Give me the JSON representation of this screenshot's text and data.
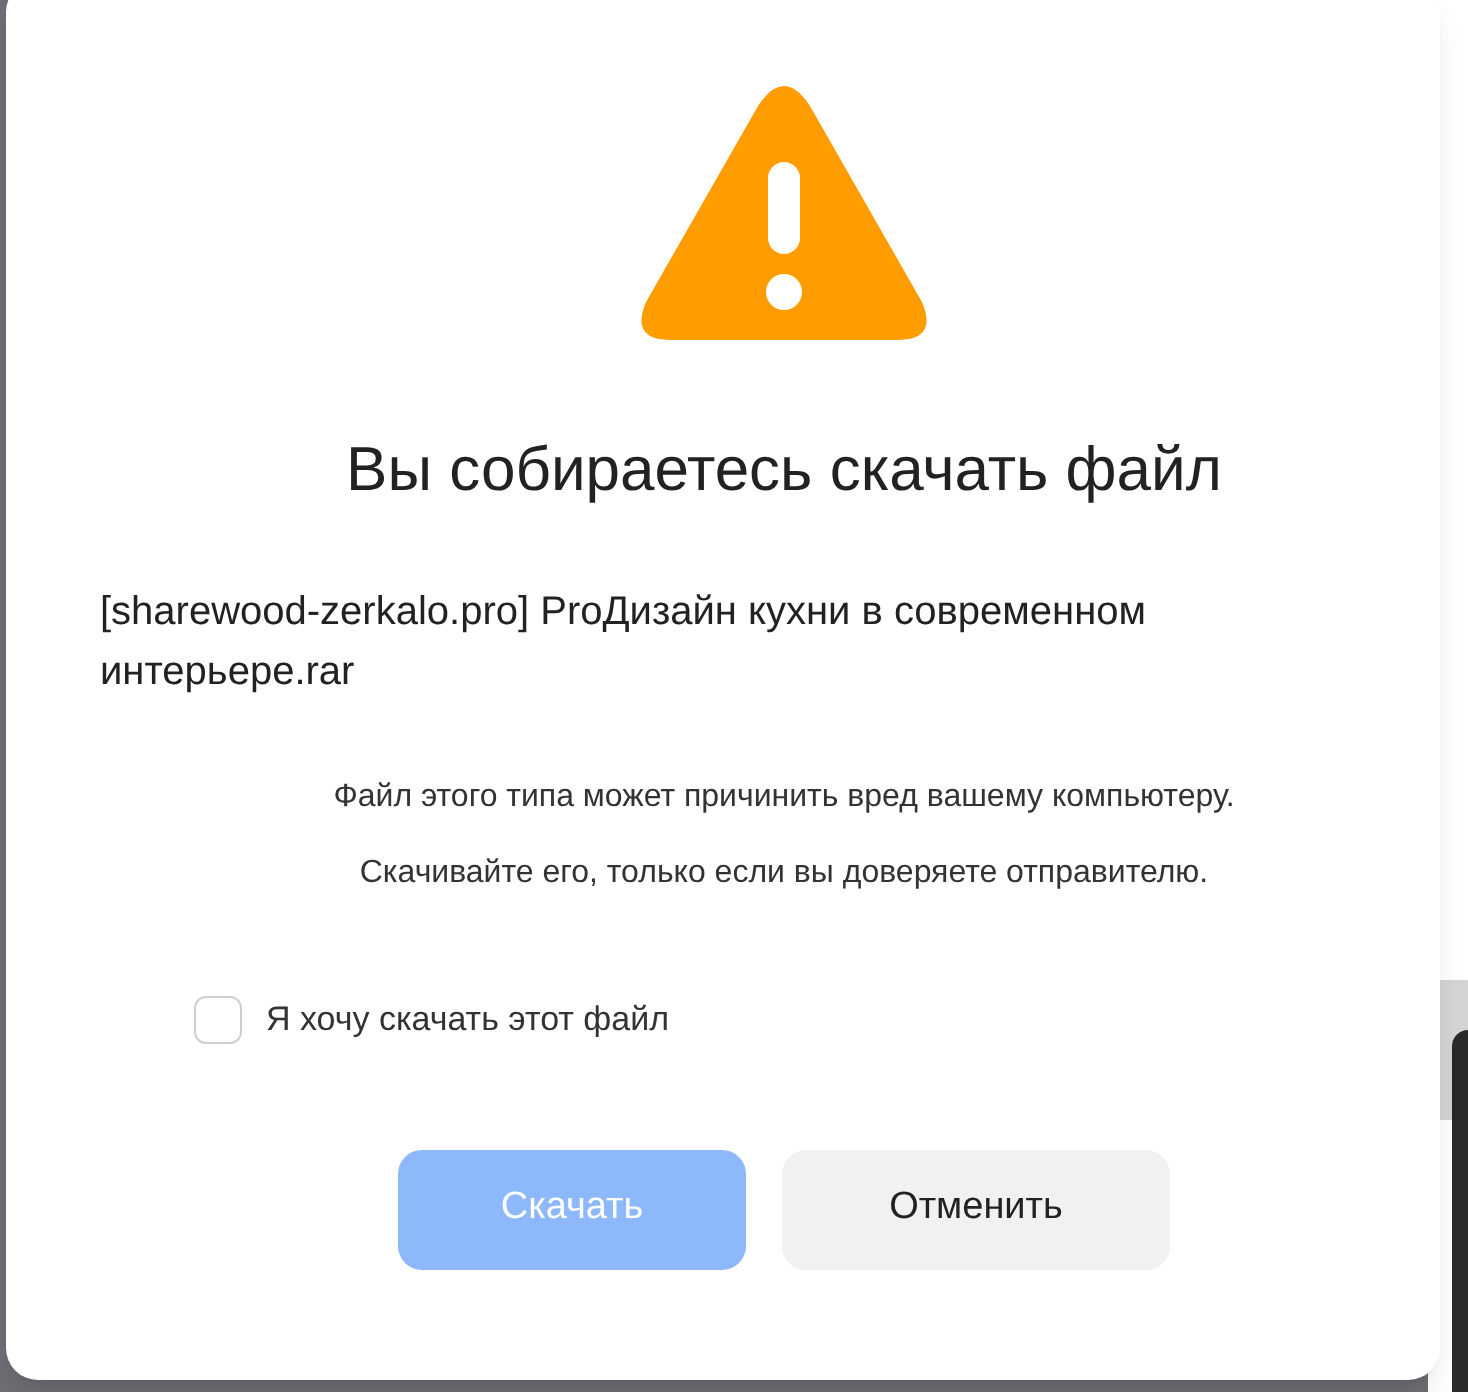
{
  "dialog": {
    "title": "Вы собираетесь скачать файл",
    "file_name": "[sharewood-zerkalo.pro] ProДизайн кухни в современном интерьере.rar",
    "warning_lines": [
      "Файл этого типа может причинить вред вашему компьютеру.",
      "Скачивайте его, только если вы доверяете отправителю."
    ],
    "confirm": {
      "label": "Я хочу скачать этот файл",
      "checked": false
    },
    "buttons": [
      {
        "kind": "primary",
        "label": "Скачать",
        "disabled": true
      },
      {
        "kind": "secondary",
        "label": "Отменить",
        "disabled": false
      }
    ]
  }
}
